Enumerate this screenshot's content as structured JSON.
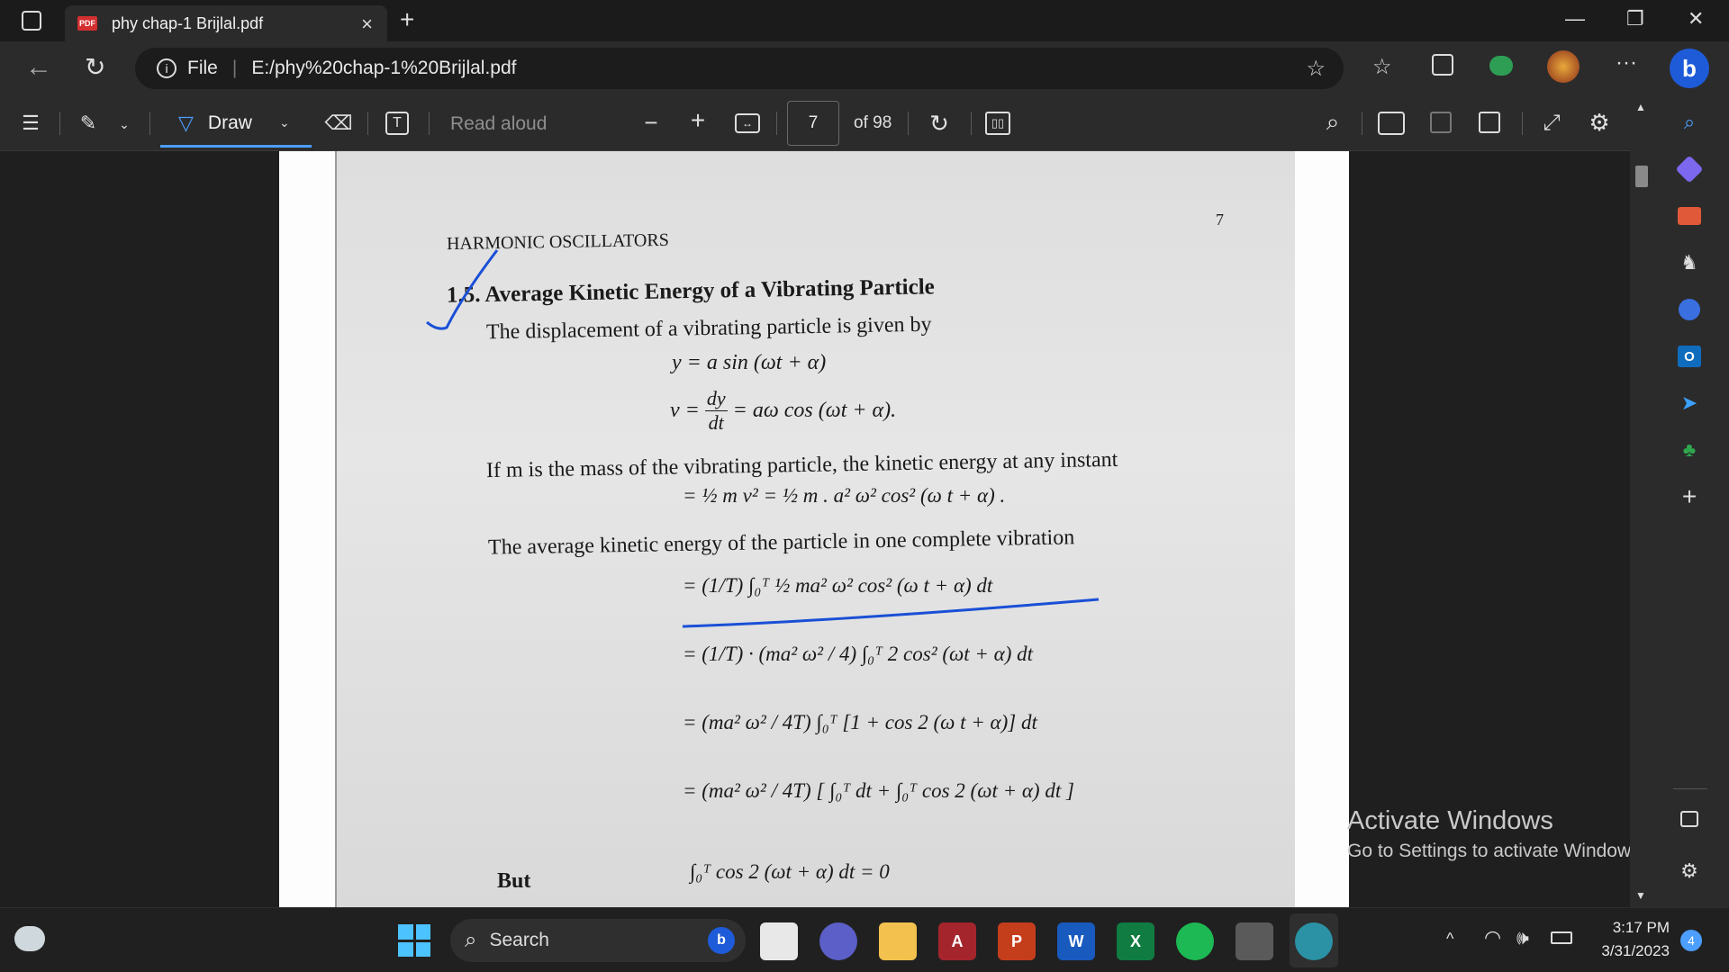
{
  "browser": {
    "tab_title": "phy chap-1 Brijlal.pdf",
    "tab_badge": "PDF",
    "new_tab": "+",
    "close_tab": "×",
    "minimize": "—",
    "restore": "❐",
    "close": "✕",
    "address_scheme": "File",
    "address_url": "E:/phy%20chap-1%20Brijlal.pdf"
  },
  "pdf_toolbar": {
    "draw_label": "Draw",
    "read_aloud": "Read aloud",
    "page_number": "7",
    "page_total": "of 98",
    "zoom_out": "−",
    "zoom_in": "+"
  },
  "document": {
    "page_num": "7",
    "header": "HARMONIC OSCILLATORS",
    "section_title": "1.5. Average Kinetic Energy of a Vibrating Particle",
    "line1": "The displacement of a vibrating particle is given by",
    "eq1": "y = a sin (ωt + α)",
    "eq2_left": "v =",
    "eq2_frac_num": "dy",
    "eq2_frac_den": "dt",
    "eq2_right": "= aω cos (ωt + α).",
    "line2": "If m is the mass of the vibrating particle, the kinetic energy at any instant",
    "eq3": "= ½ m v² = ½ m . a² ω² cos² (ω t + α) .",
    "line3": "The average kinetic energy of the particle in one complete vibration",
    "eq4": "= (1/T) ∫₀ᵀ ½ ma² ω² cos² (ω t + α) dt",
    "eq5": "= (1/T) · (ma² ω² / 4) ∫₀ᵀ 2 cos² (ωt + α) dt",
    "eq6": "= (ma² ω² / 4T) ∫₀ᵀ [1 + cos 2 (ω t + α)] dt",
    "eq7": "= (ma² ω² / 4T) [ ∫₀ᵀ dt + ∫₀ᵀ cos 2 (ωt + α) dt ]",
    "but_label": "But",
    "eq8": "∫₀ᵀ cos 2 (ωt + α) dt = 0"
  },
  "watermark": {
    "line1": "Activate Windows",
    "line2": "Go to Settings to activate Windows."
  },
  "taskbar": {
    "search_label": "Search",
    "time": "3:17 PM",
    "date": "3/31/2023",
    "notification_count": "4"
  },
  "colors": {
    "accent": "#4c9eff",
    "pen_ink": "#1a4fd6",
    "pdf_red": "#d32f2f"
  }
}
